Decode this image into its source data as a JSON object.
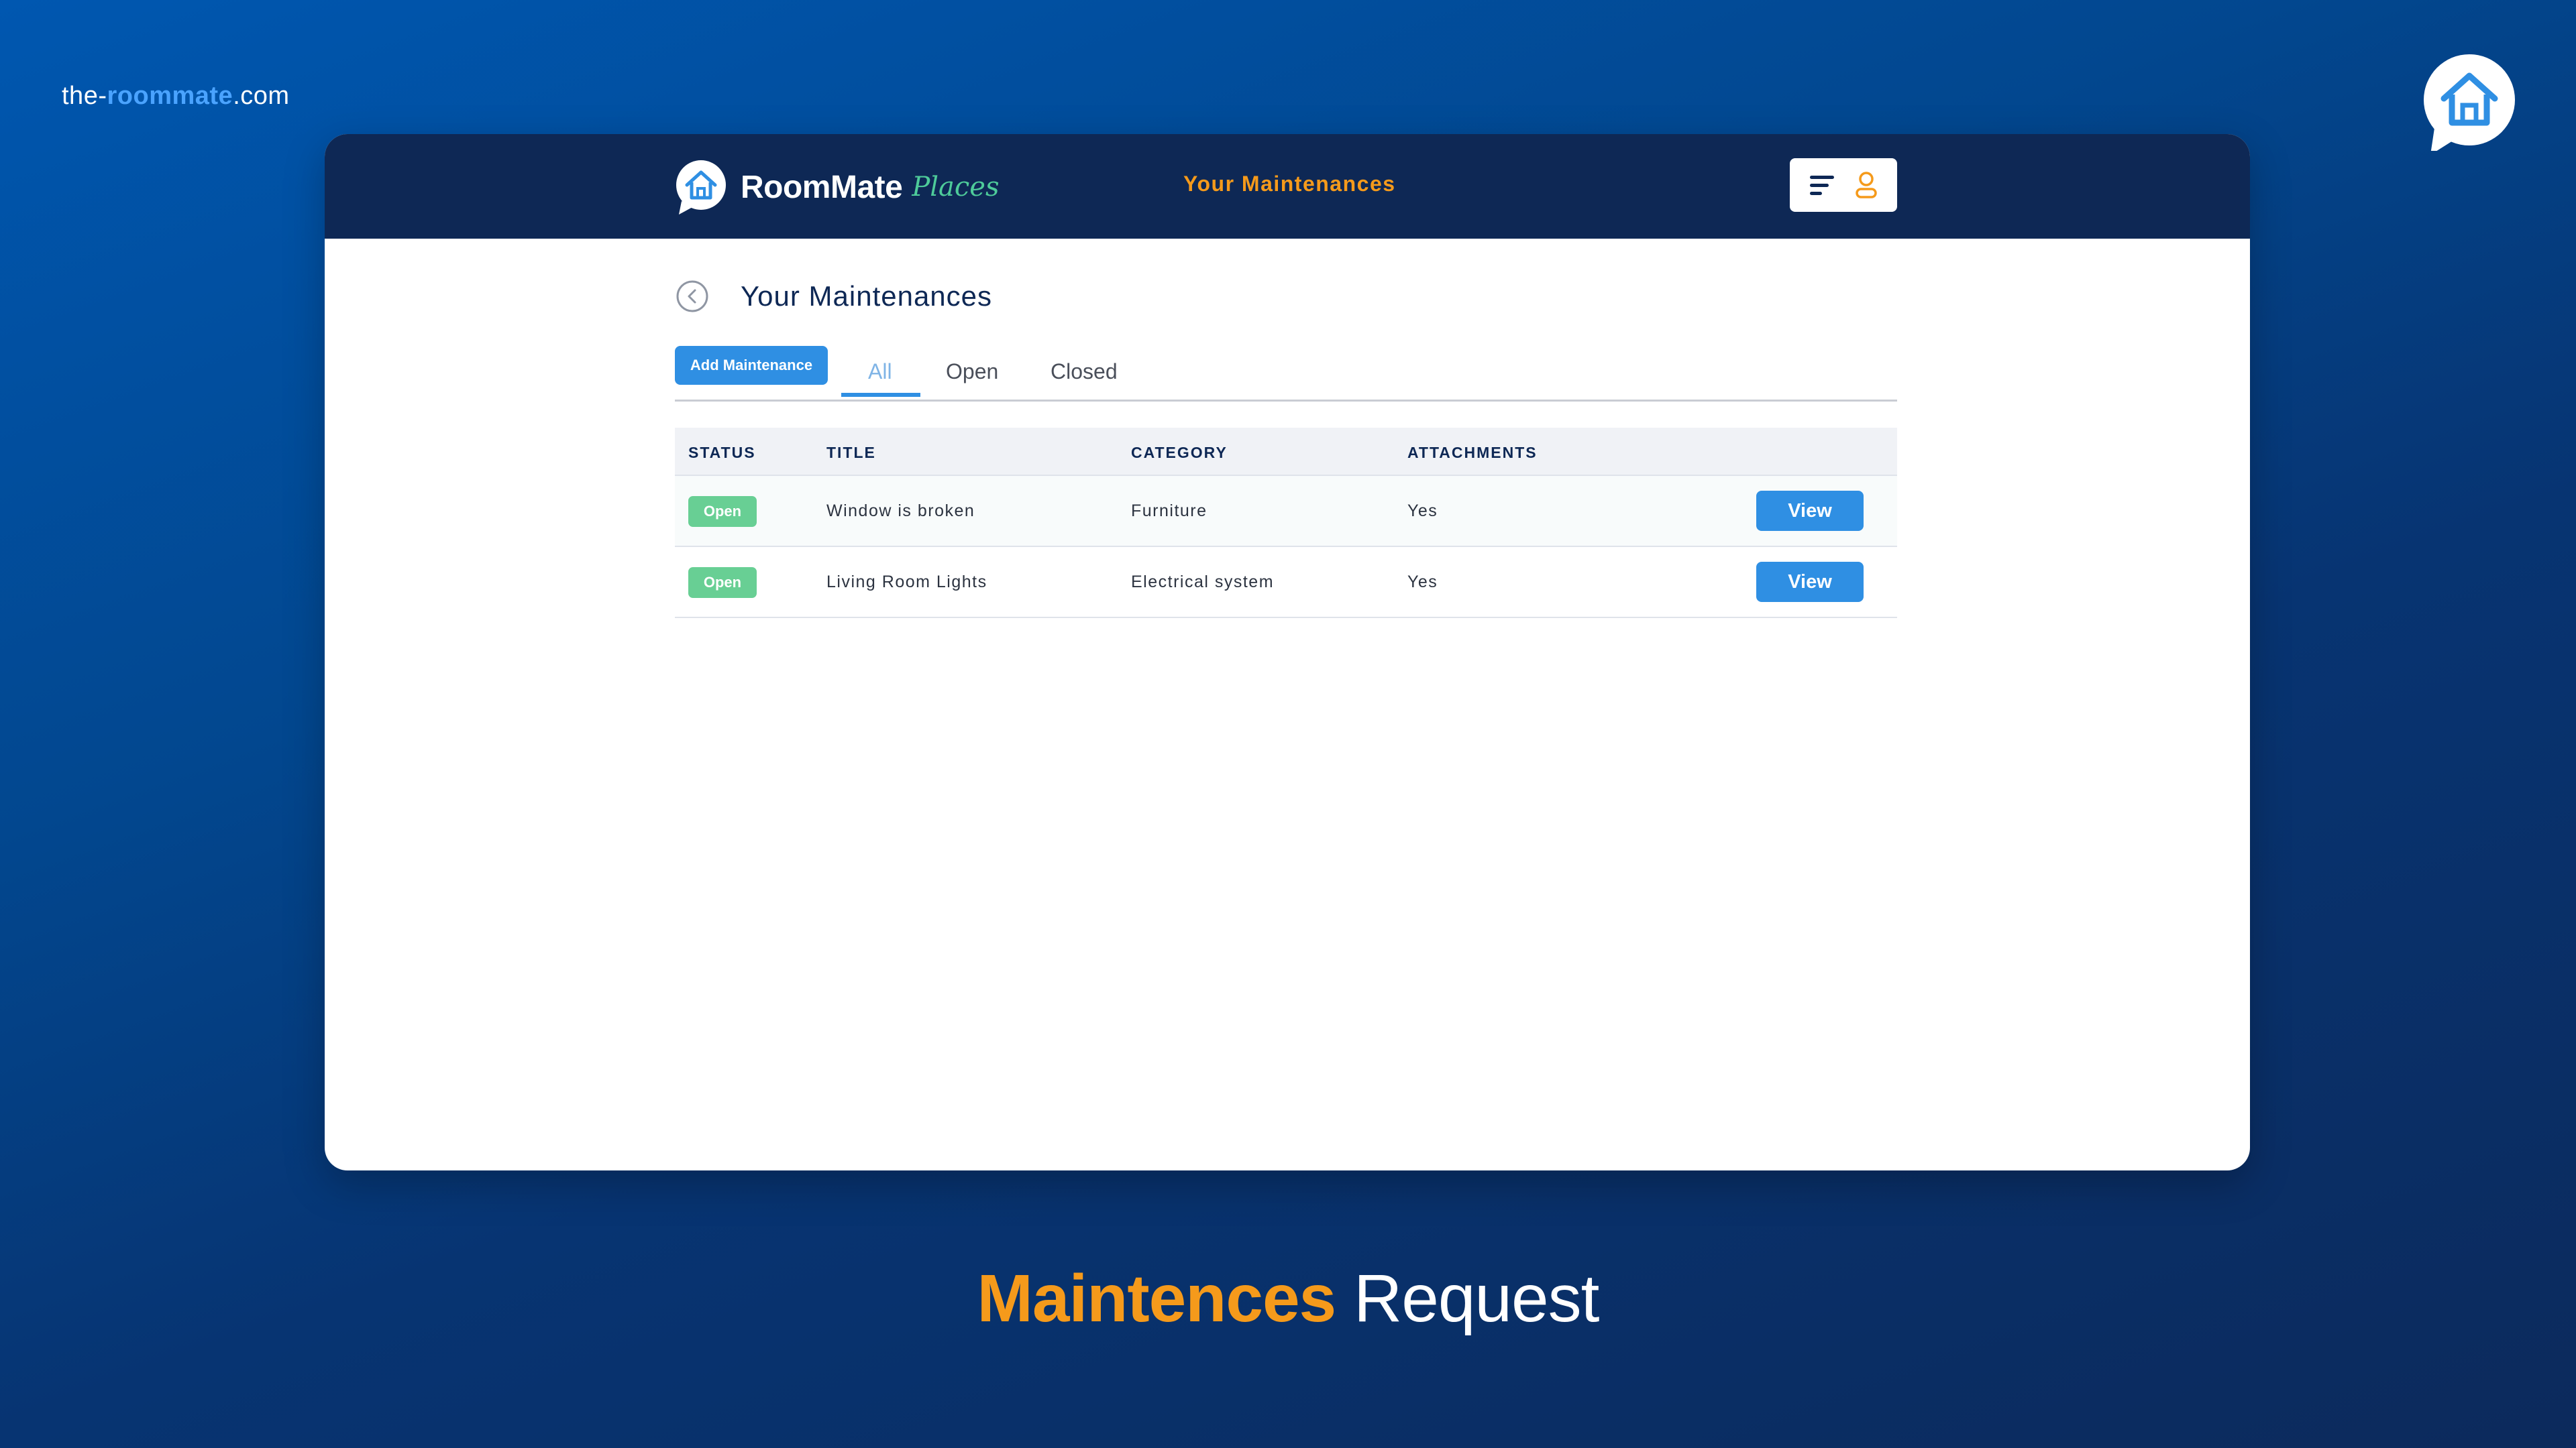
{
  "site": {
    "url_prefix": "the-",
    "url_highlight": "roommate",
    "url_suffix": ".com"
  },
  "brand": {
    "name": "RoomMate",
    "sub": "Places"
  },
  "nav": {
    "title": "Your Maintenances",
    "icons": [
      "menu-icon",
      "user-icon"
    ]
  },
  "page": {
    "title": "Your Maintenances",
    "add_button": "Add Maintenance",
    "tabs": [
      {
        "label": "All",
        "active": true
      },
      {
        "label": "Open",
        "active": false
      },
      {
        "label": "Closed",
        "active": false
      }
    ]
  },
  "table": {
    "headers": [
      "STATUS",
      "TITLE",
      "CATEGORY",
      "ATTACHMENTS"
    ],
    "rows": [
      {
        "status": "Open",
        "title": "Window is broken",
        "category": "Furniture",
        "attachments": "Yes",
        "action": "View"
      },
      {
        "status": "Open",
        "title": "Living Room Lights",
        "category": "Electrical system",
        "attachments": "Yes",
        "action": "View"
      }
    ]
  },
  "caption": {
    "highlight": "Maintences",
    "rest": "Request"
  },
  "colors": {
    "accent_orange": "#f59a1b",
    "primary_blue": "#2f8fe3",
    "navy": "#0e2855",
    "status_open": "#68cf94"
  }
}
